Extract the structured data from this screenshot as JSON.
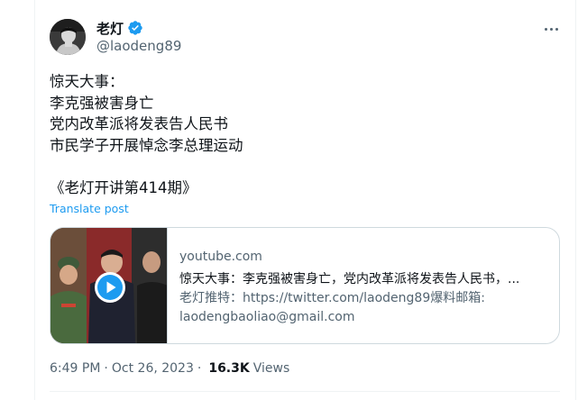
{
  "author": {
    "name": "老灯",
    "handle": "@laodeng89",
    "verified": true
  },
  "tweet": {
    "lines": [
      "惊天大事：",
      "李克强被害身亡",
      "党内改革派将发表告人民书",
      "市民学子开展悼念李总理运动",
      "",
      "《老灯开讲第414期》"
    ],
    "translate_label": "Translate post"
  },
  "link_card": {
    "domain": "youtube.com",
    "title": "惊天大事：李克强被害身亡，党内改革派将发表告人民书，...",
    "description": "老灯推特：https://twitter.com/laodeng89爆料邮箱: laodengbaoliao@gmail.com"
  },
  "meta": {
    "time": "6:49 PM",
    "date": "Oct 26, 2023",
    "separator": "·",
    "views_count": "16.3K",
    "views_label": "Views"
  },
  "colors": {
    "accent": "#1d9bf0",
    "text": "#0f1419",
    "secondary": "#536471",
    "border": "#cfd9de"
  },
  "icons": {
    "verified": "verified-badge-icon",
    "more": "more-dots-icon",
    "play": "play-icon"
  }
}
